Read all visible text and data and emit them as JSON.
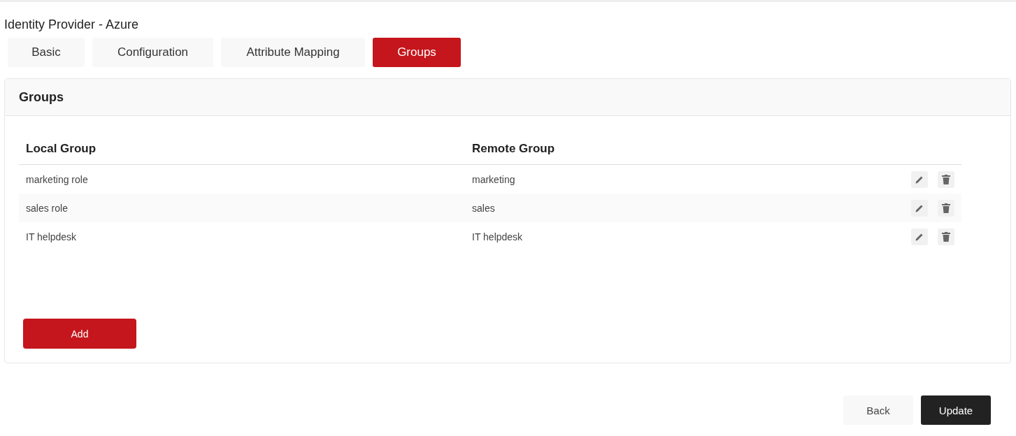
{
  "page": {
    "title": "Identity Provider - Azure"
  },
  "tabs": [
    {
      "label": "Basic",
      "selected": false
    },
    {
      "label": "Configuration",
      "selected": false
    },
    {
      "label": "Attribute Mapping",
      "selected": false
    },
    {
      "label": "Groups",
      "selected": true
    }
  ],
  "panel": {
    "title": "Groups",
    "table": {
      "columns": [
        "Local Group",
        "Remote Group"
      ],
      "rows": [
        {
          "local": "marketing role",
          "remote": "marketing"
        },
        {
          "local": "sales role",
          "remote": "sales"
        },
        {
          "local": "IT helpdesk",
          "remote": "IT helpdesk"
        }
      ]
    },
    "add_button": "Add"
  },
  "footer": {
    "back_button": "Back",
    "update_button": "Update"
  }
}
